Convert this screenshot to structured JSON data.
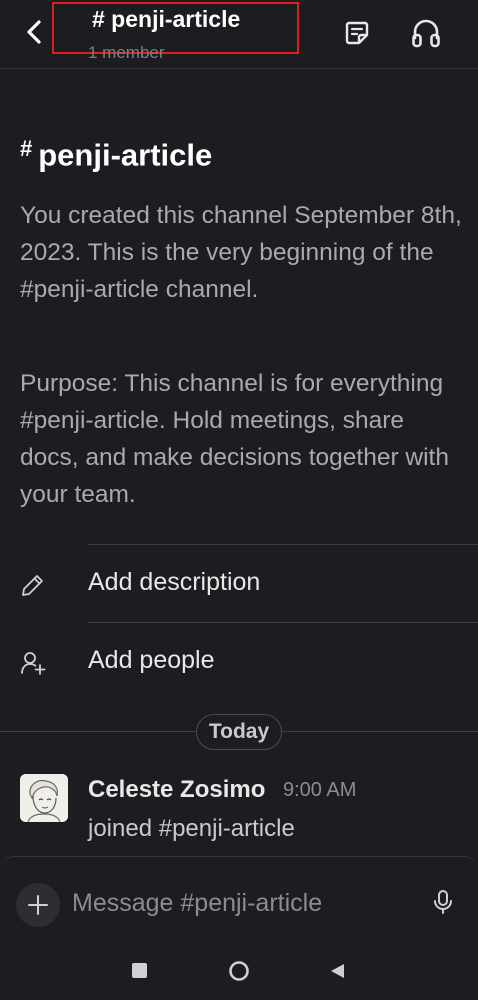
{
  "header": {
    "channel_title": "# penji-article",
    "member_count": "1 member"
  },
  "intro": {
    "hash": "#",
    "title": "penji-article",
    "created_text": "You created this channel September 8th, 2023. This is the very beginning of the #penji-article channel.",
    "purpose_text": "Purpose: This channel is for everything #penji-article. Hold meetings, share docs, and make decisions together with your team."
  },
  "actions": {
    "add_description": "Add description",
    "add_people": "Add people"
  },
  "divider": {
    "date_label": "Today"
  },
  "message": {
    "author": "Celeste Zosimo",
    "time": "9:00 AM",
    "text": "joined #penji-article"
  },
  "composer": {
    "placeholder": "Message #penji-article"
  },
  "icons": {
    "back": "chevron-left-icon",
    "canvas": "canvas-icon",
    "huddle": "headphones-icon",
    "pencil": "pencil-icon",
    "add_person": "add-person-icon",
    "plus": "plus-icon",
    "mic": "microphone-icon"
  },
  "colors": {
    "background": "#1b1d21",
    "highlight_box": "#e01e1e",
    "text_primary": "#ffffff",
    "text_secondary": "#a8aaad"
  }
}
